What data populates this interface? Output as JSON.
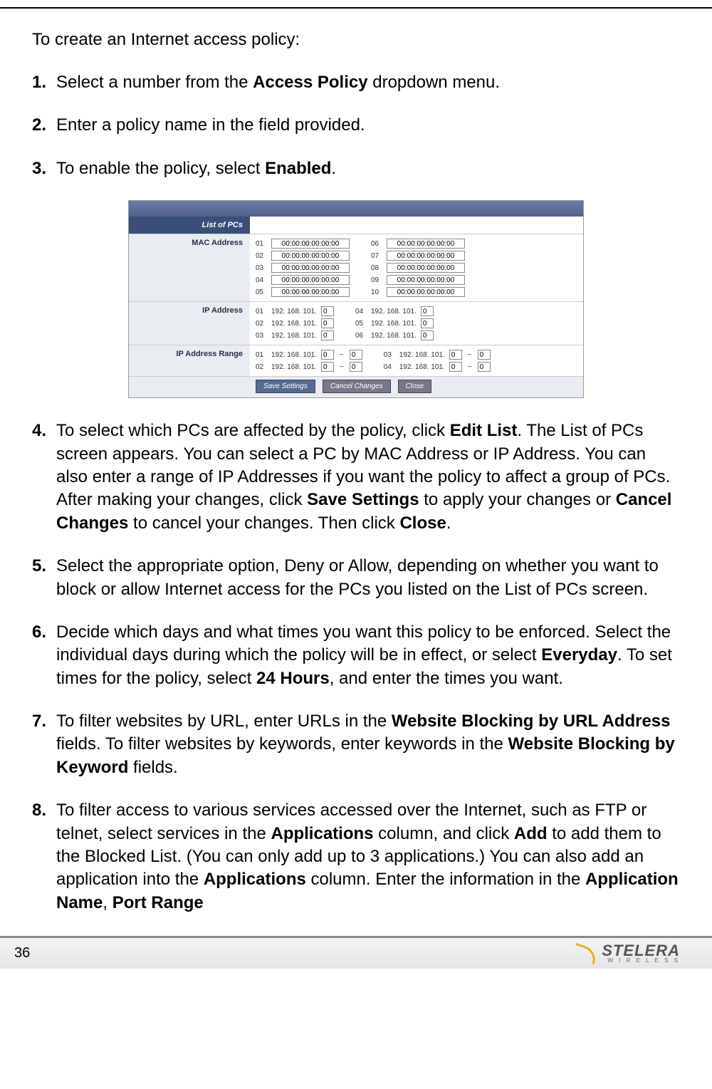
{
  "page_number": "36",
  "intro": "To create an Internet access policy:",
  "steps": {
    "s1": {
      "num": "1.",
      "p1": "Select a number from the ",
      "b1": "Access Policy",
      "p2": " dropdown menu."
    },
    "s2": {
      "num": "2.",
      "p1": "Enter a policy name in the field provided."
    },
    "s3": {
      "num": "3.",
      "p1": "To enable the policy, select ",
      "b1": "Enabled",
      "p2": "."
    },
    "s4": {
      "num": "4.",
      "p1": "To select which PCs are affected by the policy, click ",
      "b1": "Edit List",
      "p2": ". The List of PCs screen appears. You can select a PC by MAC Address or IP Address. You can also enter a range of IP Addresses if you want the policy to affect a group of PCs. After making your changes, click ",
      "b2": "Save Settings",
      "p3": " to apply your changes or ",
      "b3": "Cancel Changes",
      "p4": " to cancel your changes. Then click ",
      "b4": "Close",
      "p5": "."
    },
    "s5": {
      "num": "5.",
      "p1": "Select the appropriate option, Deny or Allow, depending on whether you want to block or allow Internet access for the PCs you listed on the List of PCs screen."
    },
    "s6": {
      "num": "6.",
      "p1": "Decide which days and what times you want this policy to be enforced. Select the individual days during which the policy will be in effect, or select ",
      "b1": "Everyday",
      "p2": ". To set times for the policy, select ",
      "b2": "24 Hours",
      "p3": ", and enter the times you want."
    },
    "s7": {
      "num": "7.",
      "p1": "To filter websites by URL, enter URLs in the ",
      "b1": "Website Blocking by URL Address",
      "p2": " fields. To filter websites by keywords, enter keywords in the ",
      "b2": "Website Blocking by Keyword",
      "p3": " fields."
    },
    "s8": {
      "num": "8.",
      "p1": "To filter access to various services accessed over the Internet, such as FTP or telnet, select services in the ",
      "b1": "Applications",
      "p2": " column, and click ",
      "b2": "Add",
      "p3": " to add them to the Blocked List. (You can only add up to 3 applications.) You can also add an application into the ",
      "b3": "Applications",
      "p4": " column. Enter the information in the ",
      "b4": "Application Name",
      "p5": ", ",
      "b5": "Port Range"
    }
  },
  "screenshot": {
    "header": "List of PCs",
    "labels": {
      "mac": "MAC Address",
      "ip": "IP Address",
      "range": "IP Address Range"
    },
    "mac_value": "00:00:00:00:00:00",
    "mac_left_idx": [
      "01",
      "02",
      "03",
      "04",
      "05"
    ],
    "mac_right_idx": [
      "06",
      "07",
      "08",
      "09",
      "10"
    ],
    "ip_prefix": "192. 168. 101.",
    "ip_oct": "0",
    "ip_left_idx": [
      "01",
      "02",
      "03"
    ],
    "ip_right_idx": [
      "04",
      "05",
      "06"
    ],
    "range_sep": "~",
    "range_left_idx": [
      "01",
      "02"
    ],
    "range_right_idx": [
      "03",
      "04"
    ],
    "buttons": {
      "save": "Save Settings",
      "cancel": "Cancel Changes",
      "close": "Close"
    }
  },
  "brand": {
    "name": "STELERA",
    "sub": "W I R E L E S S"
  }
}
